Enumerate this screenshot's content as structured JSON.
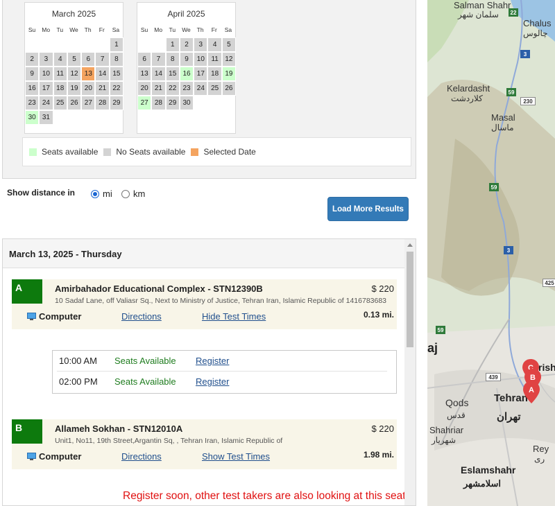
{
  "calendar": {
    "months": [
      {
        "title": "March 2025",
        "dow": [
          "Su",
          "Mo",
          "Tu",
          "We",
          "Th",
          "Fr",
          "Sa"
        ],
        "days": [
          {
            "d": "",
            "s": "empty"
          },
          {
            "d": "",
            "s": "empty"
          },
          {
            "d": "",
            "s": "empty"
          },
          {
            "d": "",
            "s": "empty"
          },
          {
            "d": "",
            "s": "empty"
          },
          {
            "d": "",
            "s": "empty"
          },
          {
            "d": "1",
            "s": "none"
          },
          {
            "d": "2",
            "s": "none"
          },
          {
            "d": "3",
            "s": "none"
          },
          {
            "d": "4",
            "s": "none"
          },
          {
            "d": "5",
            "s": "none"
          },
          {
            "d": "6",
            "s": "none"
          },
          {
            "d": "7",
            "s": "none"
          },
          {
            "d": "8",
            "s": "none"
          },
          {
            "d": "9",
            "s": "none"
          },
          {
            "d": "10",
            "s": "none"
          },
          {
            "d": "11",
            "s": "none"
          },
          {
            "d": "12",
            "s": "none"
          },
          {
            "d": "13",
            "s": "sel"
          },
          {
            "d": "14",
            "s": "none"
          },
          {
            "d": "15",
            "s": "none"
          },
          {
            "d": "16",
            "s": "none"
          },
          {
            "d": "17",
            "s": "none"
          },
          {
            "d": "18",
            "s": "none"
          },
          {
            "d": "19",
            "s": "none"
          },
          {
            "d": "20",
            "s": "none"
          },
          {
            "d": "21",
            "s": "none"
          },
          {
            "d": "22",
            "s": "none"
          },
          {
            "d": "23",
            "s": "none"
          },
          {
            "d": "24",
            "s": "none"
          },
          {
            "d": "25",
            "s": "none"
          },
          {
            "d": "26",
            "s": "none"
          },
          {
            "d": "27",
            "s": "none"
          },
          {
            "d": "28",
            "s": "none"
          },
          {
            "d": "29",
            "s": "none"
          },
          {
            "d": "30",
            "s": "avail"
          },
          {
            "d": "31",
            "s": "none"
          }
        ]
      },
      {
        "title": "April 2025",
        "dow": [
          "Su",
          "Mo",
          "Tu",
          "We",
          "Th",
          "Fr",
          "Sa"
        ],
        "days": [
          {
            "d": "",
            "s": "empty"
          },
          {
            "d": "",
            "s": "empty"
          },
          {
            "d": "1",
            "s": "none"
          },
          {
            "d": "2",
            "s": "none"
          },
          {
            "d": "3",
            "s": "none"
          },
          {
            "d": "4",
            "s": "none"
          },
          {
            "d": "5",
            "s": "none"
          },
          {
            "d": "6",
            "s": "none"
          },
          {
            "d": "7",
            "s": "none"
          },
          {
            "d": "8",
            "s": "none"
          },
          {
            "d": "9",
            "s": "none"
          },
          {
            "d": "10",
            "s": "none"
          },
          {
            "d": "11",
            "s": "none"
          },
          {
            "d": "12",
            "s": "none"
          },
          {
            "d": "13",
            "s": "none"
          },
          {
            "d": "14",
            "s": "none"
          },
          {
            "d": "15",
            "s": "none"
          },
          {
            "d": "16",
            "s": "avail"
          },
          {
            "d": "17",
            "s": "none"
          },
          {
            "d": "18",
            "s": "none"
          },
          {
            "d": "19",
            "s": "avail"
          },
          {
            "d": "20",
            "s": "none"
          },
          {
            "d": "21",
            "s": "none"
          },
          {
            "d": "22",
            "s": "none"
          },
          {
            "d": "23",
            "s": "none"
          },
          {
            "d": "24",
            "s": "none"
          },
          {
            "d": "25",
            "s": "none"
          },
          {
            "d": "26",
            "s": "none"
          },
          {
            "d": "27",
            "s": "avail"
          },
          {
            "d": "28",
            "s": "none"
          },
          {
            "d": "29",
            "s": "none"
          },
          {
            "d": "30",
            "s": "none"
          }
        ]
      }
    ],
    "legend": {
      "available": "Seats available",
      "none": "No Seats available",
      "selected": "Selected Date"
    },
    "colors": {
      "available": "#ccffcc",
      "none": "#d3d3d3",
      "selected": "#f4a460"
    }
  },
  "distance": {
    "label": "Show distance in",
    "options": [
      "mi",
      "km"
    ],
    "selected": "mi"
  },
  "load_more_label": "Load More Results",
  "results": {
    "date_header": "March 13, 2025 - Thursday",
    "sites": [
      {
        "letter": "A",
        "name": "Amirbahador Educational Complex - STN12390B",
        "address": "10 Sadaf Lane, off Valiasr Sq., Next to Ministry of Justice, Tehran Iran, Islamic Republic of 1416783683",
        "price": "$ 220",
        "type": "Computer",
        "directions": "Directions",
        "toggle_times": "Hide Test Times",
        "distance": "0.13 mi.",
        "times": [
          {
            "time": "10:00 AM",
            "status": "Seats Available",
            "action": "Register"
          },
          {
            "time": "02:00 PM",
            "status": "Seats Available",
            "action": "Register"
          }
        ]
      },
      {
        "letter": "B",
        "name": "Allameh Sokhan - STN12010A",
        "address": "Unit1, No11, 19th Street,Argantin Sq, , Tehran Iran, Islamic Republic of",
        "price": "$ 220",
        "type": "Computer",
        "directions": "Directions",
        "toggle_times": "Show Test Times",
        "distance": "1.98 mi."
      }
    ],
    "warning": "Register soon, other test takers are also looking at this seat."
  },
  "map": {
    "places": [
      {
        "en": "Salman Shahr",
        "fa": "سلمان شهر"
      },
      {
        "en": "Chalus",
        "fa": "چالوس"
      },
      {
        "en": "Kelardasht",
        "fa": "کلاردشت"
      },
      {
        "en": "Masal",
        "fa": "ماسال"
      },
      {
        "en": "Tehran",
        "fa": "تهران"
      },
      {
        "en": "Qods",
        "fa": "قدس"
      },
      {
        "en": "Shahriar",
        "fa": "شهریار"
      },
      {
        "en": "Eslamshahr",
        "fa": "اسلامشهر"
      },
      {
        "en": "Rey",
        "fa": "ری"
      }
    ],
    "roads": [
      "22",
      "3",
      "59",
      "230",
      "59",
      "3",
      "425",
      "59",
      "439"
    ],
    "pins": [
      "A",
      "B",
      "C"
    ]
  }
}
